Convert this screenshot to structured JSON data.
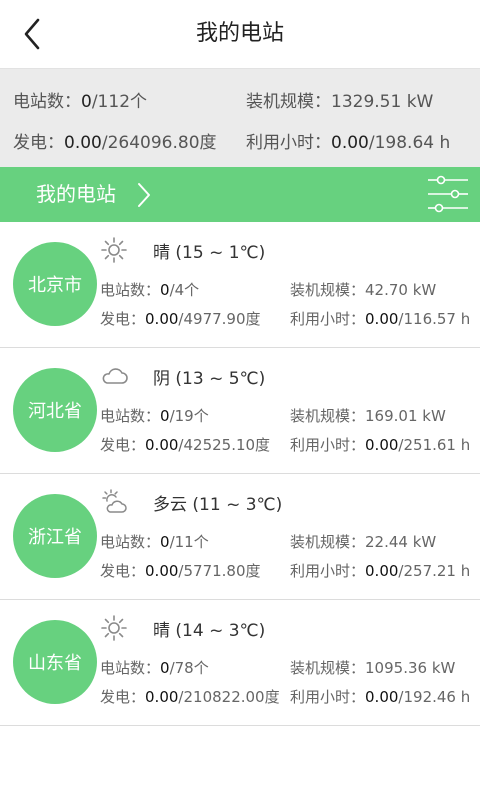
{
  "header": {
    "title": "我的电站"
  },
  "summary": {
    "station_label": "电站数：",
    "station_value": "0",
    "station_total": "/112个",
    "capacity_label": "装机规模：",
    "capacity_value": "1329.51 kW",
    "power_label": "发电：",
    "power_value": "0.00",
    "power_total": "/264096.80度",
    "hours_label": "利用小时：",
    "hours_value": "0.00",
    "hours_total": "/198.64 h"
  },
  "section": {
    "title": "我的电站"
  },
  "labels": {
    "stations": "电站数：",
    "capacity": "装机规模：",
    "power": "发电：",
    "hours": "利用小时："
  },
  "regions": [
    {
      "name": "北京市",
      "weather_icon": "sun-icon",
      "weather": "晴 (15 ~ 1℃)",
      "station_value": "0",
      "station_total": "/4个",
      "capacity": "42.70 kW",
      "power_value": "0.00",
      "power_total": "/4977.90度",
      "hours_value": "0.00",
      "hours_total": "/116.57 h"
    },
    {
      "name": "河北省",
      "weather_icon": "cloud-icon",
      "weather": "阴 (13 ~ 5℃)",
      "station_value": "0",
      "station_total": "/19个",
      "capacity": "169.01 kW",
      "power_value": "0.00",
      "power_total": "/42525.10度",
      "hours_value": "0.00",
      "hours_total": "/251.61 h"
    },
    {
      "name": "浙江省",
      "weather_icon": "partly-cloudy-icon",
      "weather": "多云 (11 ~ 3℃)",
      "station_value": "0",
      "station_total": "/11个",
      "capacity": "22.44 kW",
      "power_value": "0.00",
      "power_total": "/5771.80度",
      "hours_value": "0.00",
      "hours_total": "/257.21 h"
    },
    {
      "name": "山东省",
      "weather_icon": "sun-icon",
      "weather": "晴 (14 ~ 3℃)",
      "station_value": "0",
      "station_total": "/78个",
      "capacity": "1095.36 kW",
      "power_value": "0.00",
      "power_total": "/210822.00度",
      "hours_value": "0.00",
      "hours_total": "/192.46 h"
    }
  ],
  "colors": {
    "accent": "#67d17f",
    "summary_bg": "#ebebeb"
  }
}
